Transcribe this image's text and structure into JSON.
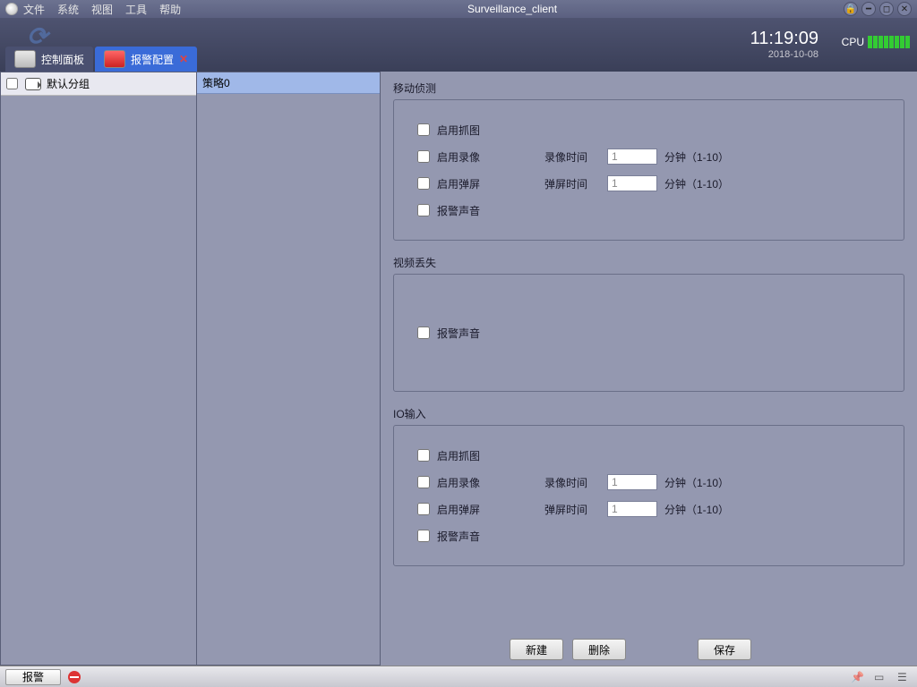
{
  "titlebar": {
    "menu": [
      "文件",
      "系统",
      "视图",
      "工具",
      "帮助"
    ],
    "title": "Surveillance_client"
  },
  "toolbar": {
    "tabs": [
      {
        "label": "控制面板"
      },
      {
        "label": "报警配置"
      }
    ],
    "time": "11:19:09",
    "date": "2018-10-08",
    "cpu_label": "CPU"
  },
  "tree": {
    "root": "默认分组"
  },
  "strategy": {
    "header": "策略0"
  },
  "groups": {
    "motion": {
      "title": "移动侦测",
      "opt_capture": "启用抓图",
      "opt_record": "启用录像",
      "record_time_label": "录像时间",
      "record_time_value": "1",
      "record_time_suffix": "分钟（1-10）",
      "opt_popup": "启用弹屏",
      "popup_time_label": "弹屏时间",
      "popup_time_value": "1",
      "popup_time_suffix": "分钟（1-10）",
      "opt_sound": "报警声音"
    },
    "videoloss": {
      "title": "视频丢失",
      "opt_sound": "报警声音"
    },
    "io": {
      "title": "IO输入",
      "opt_capture": "启用抓图",
      "opt_record": "启用录像",
      "record_time_label": "录像时间",
      "record_time_value": "1",
      "record_time_suffix": "分钟（1-10）",
      "opt_popup": "启用弹屏",
      "popup_time_label": "弹屏时间",
      "popup_time_value": "1",
      "popup_time_suffix": "分钟（1-10）",
      "opt_sound": "报警声音"
    }
  },
  "buttons": {
    "new": "新建",
    "delete": "删除",
    "save": "保存"
  },
  "statusbar": {
    "alarm": "报警"
  }
}
